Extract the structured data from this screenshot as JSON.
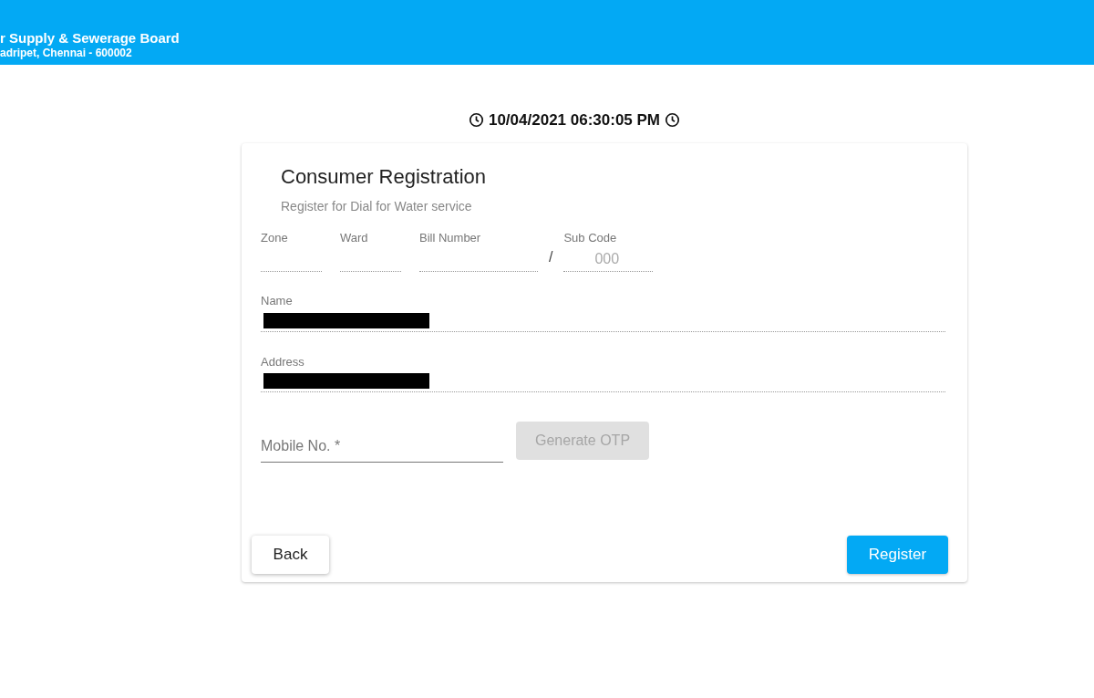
{
  "header": {
    "title": "r Supply & Sewerage Board",
    "subtitle": "adripet, Chennai - 600002"
  },
  "clock": {
    "text": "10/04/2021 06:30:05 PM"
  },
  "card": {
    "title": "Consumer Registration",
    "subtitle": "Register for Dial for Water service"
  },
  "code_fields": [
    {
      "label": "Zone",
      "disabled": true
    },
    {
      "label": "Ward",
      "disabled": true
    },
    {
      "label": "Bill Number",
      "disabled": true
    },
    {
      "label": "Sub Code",
      "placeholder": "000",
      "disabled": true
    }
  ],
  "separator": "/",
  "detail_fields": [
    {
      "label": "Name",
      "redacted": true,
      "disabled": true
    },
    {
      "label": "Address",
      "redacted": true,
      "disabled": true
    }
  ],
  "mobile": {
    "placeholder": "Mobile No. *",
    "disabled": false
  },
  "otp_button": {
    "label": "Generate OTP",
    "disabled": true
  },
  "buttons": [
    {
      "label": "Back",
      "kind": "secondary"
    },
    {
      "label": "Register",
      "kind": "primary"
    }
  ]
}
